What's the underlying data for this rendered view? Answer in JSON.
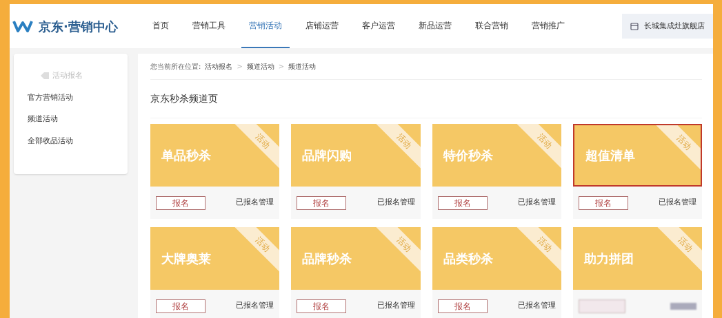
{
  "header": {
    "logo_text": "京东·营销中心",
    "nav": [
      {
        "label": "首页",
        "selected": false
      },
      {
        "label": "营销工具",
        "selected": false
      },
      {
        "label": "营销活动",
        "selected": true
      },
      {
        "label": "店铺运营",
        "selected": false
      },
      {
        "label": "客户运营",
        "selected": false
      },
      {
        "label": "新品运营",
        "selected": false
      },
      {
        "label": "联合营销",
        "selected": false
      },
      {
        "label": "营销推广",
        "selected": false
      }
    ],
    "store": "长城集成灶旗舰店"
  },
  "sidebar": {
    "heading": "活动报名",
    "items": [
      {
        "label": "官方营销活动"
      },
      {
        "label": "频道活动"
      },
      {
        "label": "全部收品活动"
      }
    ]
  },
  "breadcrumb": {
    "prefix": "您当前所在位置:",
    "items": [
      "活动报名",
      "频道活动",
      "频道活动"
    ],
    "separator": ">"
  },
  "page_title": "京东秒杀频道页",
  "cards": [
    {
      "title": "单品秒杀",
      "ribbon": "活动",
      "button": "报名",
      "link": "已报名管理",
      "selected": false
    },
    {
      "title": "品牌闪购",
      "ribbon": "活动",
      "button": "报名",
      "link": "已报名管理",
      "selected": false
    },
    {
      "title": "特价秒杀",
      "ribbon": "活动",
      "button": "报名",
      "link": "已报名管理",
      "selected": false
    },
    {
      "title": "超值清单",
      "ribbon": "活动",
      "button": "报名",
      "link": "已报名管理",
      "selected": true
    },
    {
      "title": "大牌奥莱",
      "ribbon": "活动",
      "button": "报名",
      "link": "已报名管理",
      "selected": false
    },
    {
      "title": "品牌秒杀",
      "ribbon": "活动",
      "button": "报名",
      "link": "已报名管理",
      "selected": false
    },
    {
      "title": "品类秒杀",
      "ribbon": "活动",
      "button": "报名",
      "link": "已报名管理",
      "selected": false
    },
    {
      "title": "助力拼团",
      "ribbon": "活动",
      "selected": false
    }
  ]
}
